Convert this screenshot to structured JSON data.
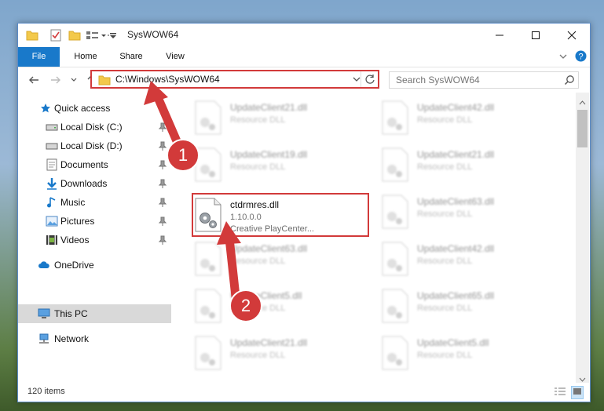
{
  "window": {
    "title": "SysWOW64",
    "controls": {
      "minimize": "minimize-icon",
      "maximize": "maximize-icon",
      "close": "close-icon"
    }
  },
  "ribbon": {
    "tabs": [
      {
        "label": "File"
      },
      {
        "label": "Home"
      },
      {
        "label": "Share"
      },
      {
        "label": "View"
      }
    ]
  },
  "address": {
    "path": "C:\\Windows\\SysWOW64"
  },
  "search": {
    "placeholder": "Search SysWOW64"
  },
  "sidebar": {
    "items": [
      {
        "label": "Quick access",
        "icon": "star-icon",
        "pinned": false
      },
      {
        "label": "Local Disk (C:)",
        "icon": "drive-icon",
        "pinned": true
      },
      {
        "label": "Local Disk (D:)",
        "icon": "drive-icon",
        "pinned": true
      },
      {
        "label": "Documents",
        "icon": "documents-icon",
        "pinned": true
      },
      {
        "label": "Downloads",
        "icon": "downloads-icon",
        "pinned": true
      },
      {
        "label": "Music",
        "icon": "music-icon",
        "pinned": true
      },
      {
        "label": "Pictures",
        "icon": "pictures-icon",
        "pinned": true
      },
      {
        "label": "Videos",
        "icon": "videos-icon",
        "pinned": true
      },
      {
        "label": "OneDrive",
        "icon": "cloud-icon",
        "pinned": false
      },
      {
        "label": "This PC",
        "icon": "computer-icon",
        "pinned": false,
        "selected": true
      },
      {
        "label": "Network",
        "icon": "network-icon",
        "pinned": false
      }
    ]
  },
  "files": [
    {
      "name": "UpdateClient21.dll",
      "type": "Resource DLL"
    },
    {
      "name": "UpdateClient42.dll",
      "type": "Resource DLL"
    },
    {
      "name": "UpdateClient19.dll",
      "type": "Resource DLL"
    },
    {
      "name": "UpdateClient21.dll",
      "type": "Resource DLL"
    },
    {
      "name": "ctdrmres.dll",
      "version": "1.10.0.0",
      "description": "Creative PlayCenter...",
      "selected": true
    },
    {
      "name": "UpdateClient63.dll",
      "type": "Resource DLL"
    },
    {
      "name": "UpdateClient63.dll",
      "type": "Resource DLL"
    },
    {
      "name": "UpdateClient42.dll",
      "type": "Resource DLL"
    },
    {
      "name": "UpdateClient5.dll",
      "type": "Resource DLL"
    },
    {
      "name": "UpdateClient65.dll",
      "type": "Resource DLL"
    },
    {
      "name": "UpdateClient21.dll",
      "type": "Resource DLL"
    },
    {
      "name": "UpdateClient5.dll",
      "type": "Resource DLL"
    }
  ],
  "status": {
    "item_count": "120 items"
  },
  "annotations": {
    "badge1": "1",
    "badge2": "2",
    "color": "#d23a3a"
  }
}
